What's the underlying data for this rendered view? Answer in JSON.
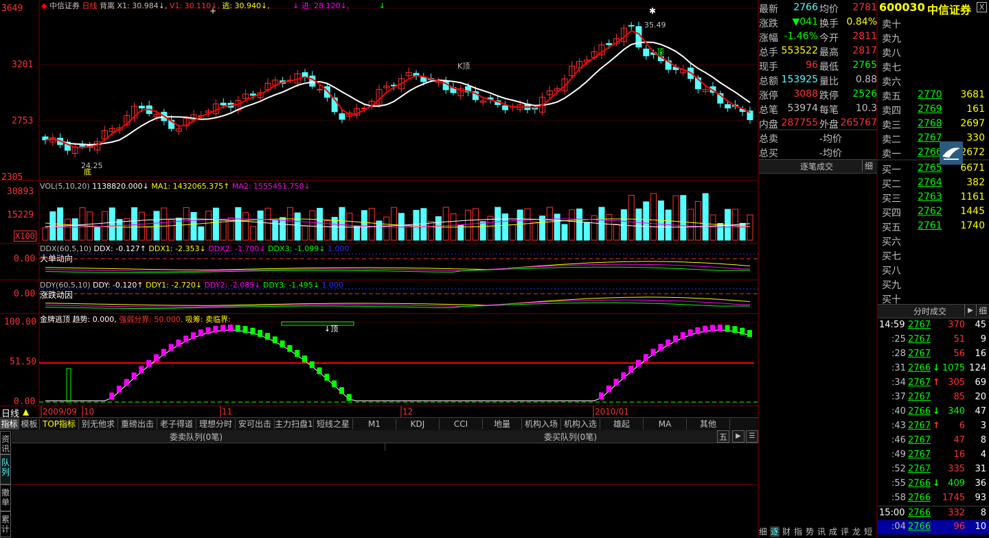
{
  "title_bar": {
    "stock_name": "中信证券",
    "period": "日线",
    "mode": "背离",
    "x1": "X1: 30.984↓,",
    "v1": "V1: 30.110↓,",
    "tao": "逃: 30.940↓,",
    "jin": "↓  进: 28.120↓,",
    "mark": "↓"
  },
  "price_axis": [
    "3649",
    "3201",
    "2753",
    "2305"
  ],
  "annotations": {
    "high": "35.49",
    "low": "24.25",
    "di": "底",
    "ding": "顶",
    "kding": "K顶"
  },
  "vol_header": {
    "name": "VOL(5,10,20)",
    "v": "1138820.000↓",
    "ma1": "MA1: 1432065.375↑",
    "ma2": "MA2: 1555451.750↓"
  },
  "vol_axis": [
    "30893",
    "15229",
    "X100"
  ],
  "ddx_header": {
    "name": "DDX(60,5,10)",
    "ddx": "DDX: -0.127↑",
    "ddx1": "DDX1: -2.353↓",
    "ddx2": "DDX2: -1.700↓",
    "ddx3": "DDX3: -1.099↓",
    "c": "1.000",
    "label": "大单动向",
    "axis": "0.00"
  },
  "ddy_header": {
    "name": "DDY(60,5,10)",
    "ddy": "DDY: -0.120↑",
    "ddy1": "DDY1: -2.720↓",
    "ddy2": "DDY2: -2.085↓",
    "ddy3": "DDY3: -1.495↓",
    "c": "1.000",
    "label": "涨跌动因",
    "axis": "0.00"
  },
  "gold_header": {
    "name": "金牌逃顶",
    "trend": "趋势: 0.000,",
    "strong": "强弱分界: 50.000,",
    "xichou": "吸筹: 卖临界:",
    "axis": [
      "100.00",
      "51.50",
      "0.00"
    ],
    "ding": "↓顶"
  },
  "date_axis": {
    "period_label": "日线",
    "d1": "2009/09",
    "d2": "10",
    "d3": "11",
    "d4": "12",
    "d5": "2010/01"
  },
  "tabs": [
    "指标",
    "模板",
    "TOP指标",
    "别无他求",
    "重磅出击",
    "老子得道",
    "理想分时",
    "安可出击",
    "主力扫盘1",
    "短线之星",
    "M1",
    "KDJ",
    "CCI",
    "地量",
    "机构入场",
    "机构入选",
    "雄起",
    "MA",
    "其他"
  ],
  "queue": {
    "sell": "委卖队列(0笔)",
    "buy": "委买队列(0笔)",
    "five": "五"
  },
  "side_tabs": [
    "资讯",
    "队列",
    "撤单",
    "累计"
  ],
  "quote": {
    "rows": [
      {
        "l1": "最新",
        "v1": "2766",
        "l2": "均价",
        "v2": "2781"
      },
      {
        "l1": "涨跌",
        "v1": "▼041",
        "l2": "换手",
        "v2": "0.84%"
      },
      {
        "l1": "涨幅",
        "v1": "-1.46%",
        "l2": "今开",
        "v2": "2811"
      },
      {
        "l1": "总手",
        "v1": "553522",
        "l2": "最高",
        "v2": "2817"
      },
      {
        "l1": "现手",
        "v1": "96",
        "l2": "最低",
        "v2": "2765"
      },
      {
        "l1": "总额",
        "v1": "153925",
        "l2": "量比",
        "v2": "0.88"
      },
      {
        "l1": "涨停",
        "v1": "3088",
        "l2": "跌停",
        "v2": "2526"
      },
      {
        "l1": "总笔",
        "v1": "53974",
        "l2": "每笔",
        "v2": "10.3"
      },
      {
        "l1": "内盘",
        "v1": "287755",
        "l2": "外盘",
        "v2": "265767"
      },
      {
        "l1": "总卖",
        "v1": "",
        "l2": "-均价",
        "v2": ""
      },
      {
        "l1": "总买",
        "v1": "",
        "l2": "-均价",
        "v2": ""
      }
    ],
    "tick_label": "逐笔成交",
    "detail": "细"
  },
  "stock_header": {
    "code": "600030",
    "name": "中信证券",
    "close": "X"
  },
  "orderbook": [
    {
      "l": "卖十",
      "p": "",
      "v": ""
    },
    {
      "l": "卖九",
      "p": "",
      "v": ""
    },
    {
      "l": "卖八",
      "p": "",
      "v": ""
    },
    {
      "l": "卖七",
      "p": "",
      "v": ""
    },
    {
      "l": "卖六",
      "p": "",
      "v": ""
    },
    {
      "l": "卖五",
      "p": "2770",
      "v": "3681"
    },
    {
      "l": "卖四",
      "p": "2769",
      "v": "161"
    },
    {
      "l": "卖三",
      "p": "2768",
      "v": "2697"
    },
    {
      "l": "卖二",
      "p": "2767",
      "v": "330"
    },
    {
      "l": "卖一",
      "p": "2766",
      "v": "2672"
    },
    {
      "l": "买一",
      "p": "2765",
      "v": "6671"
    },
    {
      "l": "买二",
      "p": "2764",
      "v": "382"
    },
    {
      "l": "买三",
      "p": "2763",
      "v": "1161"
    },
    {
      "l": "买四",
      "p": "2762",
      "v": "1445"
    },
    {
      "l": "买五",
      "p": "2761",
      "v": "1740"
    },
    {
      "l": "买六",
      "p": "",
      "v": ""
    },
    {
      "l": "买七",
      "p": "",
      "v": ""
    },
    {
      "l": "买八",
      "p": "",
      "v": ""
    },
    {
      "l": "买九",
      "p": "",
      "v": ""
    },
    {
      "l": "买十",
      "p": "",
      "v": ""
    }
  ],
  "ticks_header": {
    "label": "分时成交",
    "arrow": "▶",
    "detail": "细"
  },
  "ticks": [
    {
      "t": "14:59",
      "p": "2767",
      "a": "",
      "v": "370",
      "n": "45"
    },
    {
      "t": ":25",
      "p": "2767",
      "a": "",
      "v": "51",
      "n": "9"
    },
    {
      "t": ":28",
      "p": "2767",
      "a": "",
      "v": "56",
      "n": "16"
    },
    {
      "t": ":31",
      "p": "2766",
      "a": "↓",
      "v": "1075",
      "n": "124"
    },
    {
      "t": ":34",
      "p": "2767",
      "a": "↑",
      "v": "305",
      "n": "69"
    },
    {
      "t": ":37",
      "p": "2767",
      "a": "",
      "v": "85",
      "n": "20"
    },
    {
      "t": ":40",
      "p": "2766",
      "a": "↓",
      "v": "340",
      "n": "47"
    },
    {
      "t": ":43",
      "p": "2767",
      "a": "↑",
      "v": "6",
      "n": "3"
    },
    {
      "t": ":46",
      "p": "2767",
      "a": "",
      "v": "47",
      "n": "8"
    },
    {
      "t": ":49",
      "p": "2767",
      "a": "",
      "v": "16",
      "n": "4"
    },
    {
      "t": ":52",
      "p": "2767",
      "a": "",
      "v": "335",
      "n": "31"
    },
    {
      "t": ":55",
      "p": "2766",
      "a": "↓",
      "v": "409",
      "n": "36"
    },
    {
      "t": ":58",
      "p": "2766",
      "a": "",
      "v": "1745",
      "n": "93"
    },
    {
      "t": "15:00",
      "p": "2766",
      "a": "",
      "v": "332",
      "n": "8"
    },
    {
      "t": ":04",
      "p": "2766",
      "a": "",
      "v": "96",
      "n": "10"
    }
  ],
  "bottom_tabs": [
    "细",
    "逐",
    "财",
    "指",
    "势",
    "讯",
    "成",
    "评",
    "龙",
    "短"
  ],
  "colors": {
    "up": "#ff3232",
    "down": "#54ffff",
    "white": "#ffffff",
    "yellow": "#ffff00",
    "green": "#00ff00",
    "magenta": "#ff00ff",
    "axis": "#800000"
  }
}
